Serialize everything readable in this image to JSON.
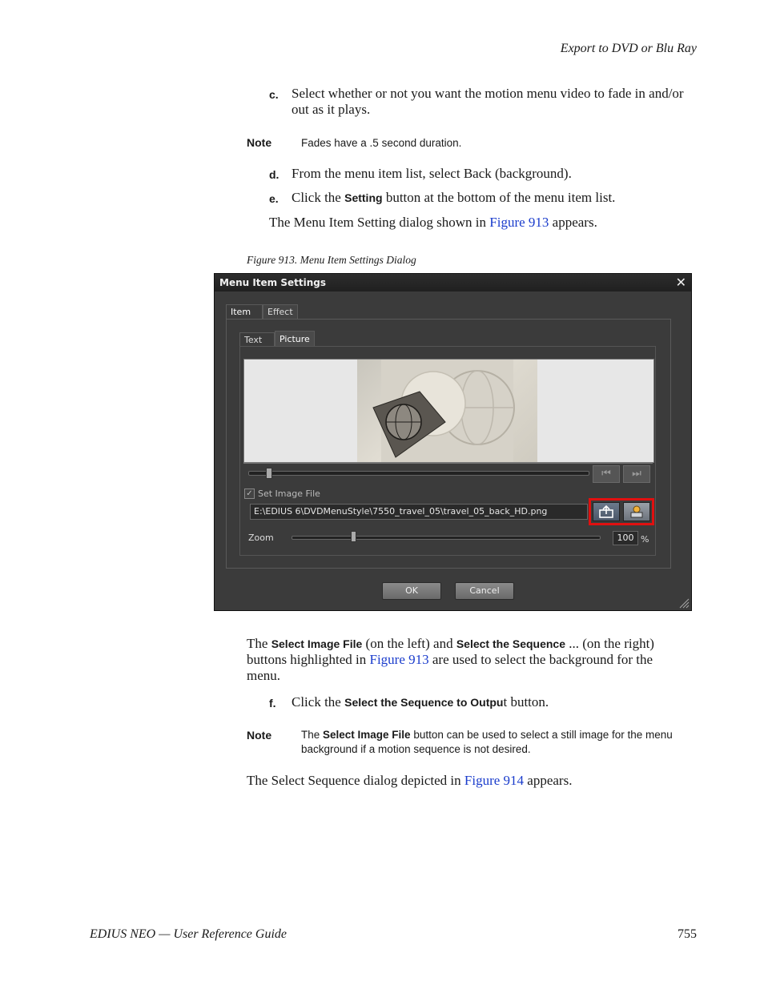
{
  "header": {
    "title": "Export to DVD or Blu Ray"
  },
  "step_c": {
    "letter": "c.",
    "text": "Select whether or not you want the motion menu video to fade in and/or out as it plays."
  },
  "note1": {
    "label": "Note",
    "text": "Fades have a .5 second duration."
  },
  "step_d": {
    "letter": "d.",
    "text": "From the menu item list, select Back (background)."
  },
  "step_e": {
    "letter": "e.",
    "pre": "Click the ",
    "bold": "Setting",
    "post": " button at the bottom of the menu item list."
  },
  "para1": {
    "pre": "The Menu Item Setting dialog shown in ",
    "link": "Figure 913",
    "post": " appears."
  },
  "figure_caption": "Figure 913.  Menu Item Settings Dialog",
  "dialog": {
    "title": "Menu Item Settings",
    "close": "✕",
    "tabs_top": [
      "Item",
      "Effect"
    ],
    "tabs_inner": [
      "Text",
      "Picture"
    ],
    "set_image_label": "Set Image File",
    "file_path": "E:\\EDIUS 6\\DVDMenuStyle\\7550_travel_05\\travel_05_back_HD.png",
    "zoom_label": "Zoom",
    "zoom_value": "100",
    "zoom_unit": "%",
    "ok": "OK",
    "cancel": "Cancel"
  },
  "para2": {
    "t1": "The ",
    "b1": "Select Image File",
    "t2": " (on the left) and ",
    "b2": "Select the Sequence",
    "t3": " ... (on the right)",
    "line2_pre": "buttons highlighted in ",
    "line2_link": "Figure 913",
    "line2_post": " are used to select the background for the",
    "line3": "menu."
  },
  "step_f": {
    "letter": "f.",
    "pre": "Click the ",
    "bold": "Select the Sequence to Outpu",
    "post": "t button."
  },
  "note2": {
    "label": "Note",
    "pre": "The ",
    "bold": "Select Image File",
    "post": " button can be used to select a still image for the menu",
    "line2": "background if a motion sequence is not desired."
  },
  "para3": {
    "pre": "The Select Sequence dialog depicted in ",
    "link": "Figure 914",
    "post": " appears."
  },
  "footer": {
    "left": "EDIUS NEO  —  User Reference Guide",
    "right": "755"
  }
}
